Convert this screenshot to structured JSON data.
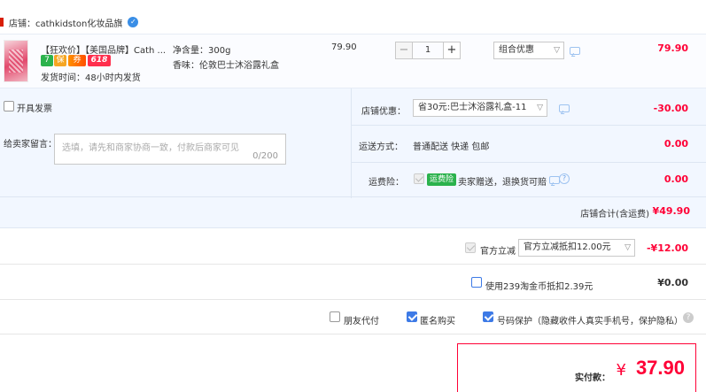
{
  "store": {
    "label": "店铺：cathkidston化妆品旗"
  },
  "item": {
    "title": "【狂欢价】【美国品牌】Cath ...",
    "tags": {
      "seven": "7",
      "guard": "保",
      "coupon": "券",
      "promo": "618"
    },
    "ship_time": "发货时间：48小时内发货",
    "spec_weight": "净含量：300g",
    "spec_scent": "香味：伦敦巴士沐浴露礼盒",
    "unit_price": "79.90",
    "quantity": "1",
    "promo_select": "组合优惠",
    "total": "79.90"
  },
  "options": {
    "invoice_label": "开具发票",
    "message_label": "给卖家留言：",
    "message_placeholder": "选填，请先和商家协商一致，付款后商家可见",
    "message_counter": "0/200",
    "store_discount_label": "店铺优惠：",
    "store_discount_select": "省30元:巴士沐浴露礼盒-11",
    "store_discount_value": "-30.00",
    "shipping_label": "运送方式：",
    "shipping_value": "普通配送 快递 包邮",
    "shipping_price": "0.00",
    "insurance_label": "运费险：",
    "insurance_tag": "运费险",
    "insurance_text": "卖家赠送，退换货可赔",
    "insurance_price": "0.00",
    "subtotal_label": "店铺合计(含运费)",
    "subtotal_value": "¥49.90"
  },
  "official": {
    "label": "官方立减",
    "select": "官方立减抵扣12.00元",
    "value": "-¥12.00"
  },
  "coins": {
    "label": "使用239淘金币抵扣2.39元",
    "value": "¥0.00"
  },
  "extras": {
    "friend_pay": "朋友代付",
    "anonymous": "匿名购买",
    "privacy": "号码保护（隐藏收件人真实手机号，保护隐私）"
  },
  "payment": {
    "label": "实付款：",
    "currency": "¥",
    "amount": "37.90"
  },
  "colors": {
    "price_red": "#ff0036",
    "accent_blue": "#3d7ae6",
    "panel_bg": "#f2f7ff",
    "ship_orange": "#ff6a00"
  }
}
